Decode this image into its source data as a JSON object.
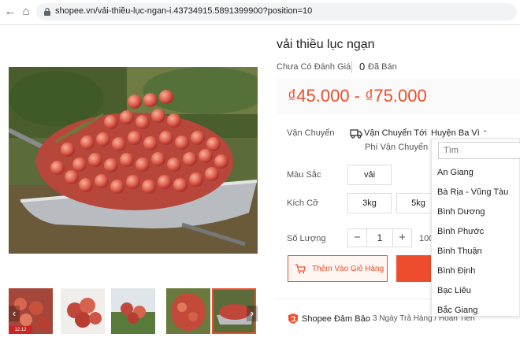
{
  "browser": {
    "url": "shopee.vn/vải-thiều-lục-ngan-i.43734915.5891399900?position=10"
  },
  "product": {
    "title": "vải thiều lục ngạn",
    "rating_text": "Chưa Có Đánh Giá",
    "sold_count": "0",
    "sold_label": "Đã Bán",
    "price": "₫45.000 - ₫75.000",
    "thumb_badge": "12.12"
  },
  "shipping": {
    "label": "Vận Chuyển",
    "to_label": "Vận Chuyển Tới",
    "fee_label": "Phí Vận Chuyển",
    "district": "Huyện Ba Vì"
  },
  "color": {
    "label": "Màu Sắc",
    "options": [
      "vải"
    ]
  },
  "size": {
    "label": "Kích Cỡ",
    "options": [
      "3kg",
      "5kg"
    ]
  },
  "quantity": {
    "label": "Số Lượng",
    "minus": "−",
    "value": "1",
    "plus": "+",
    "stock_text": "100"
  },
  "actions": {
    "add_to_cart": "Thêm Vào Giỏ Hàng"
  },
  "guarantee": {
    "label": "Shopee Đảm Bảo",
    "return_text": "3 Ngày Trả Hàng / Hoàn Tiền"
  },
  "dropdown": {
    "placeholder": "Tìm",
    "provinces": [
      "An Giang",
      "Bà Rịa - Vũng Tàu",
      "Bình Dương",
      "Bình Phước",
      "Bình Thuận",
      "Bình Định",
      "Bạc Liêu",
      "Bắc Giang"
    ]
  },
  "colors": {
    "accent": "#ee4d2d"
  }
}
